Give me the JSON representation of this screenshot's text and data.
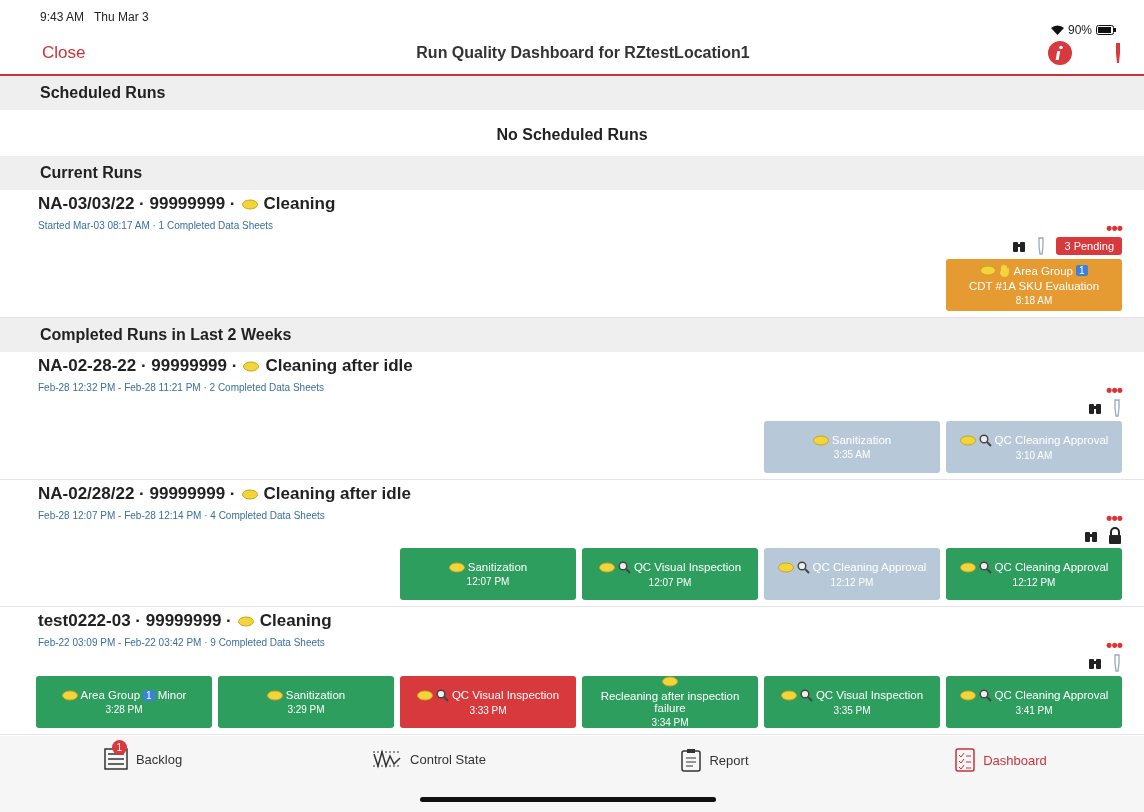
{
  "status_bar": {
    "time": "9:43 AM",
    "date": "Thu Mar 3",
    "battery": "90%"
  },
  "nav": {
    "close": "Close",
    "title": "Run Quality Dashboard for RZtestLocation1"
  },
  "scheduled": {
    "header": "Scheduled Runs",
    "empty": "No Scheduled Runs"
  },
  "current": {
    "header": "Current Runs",
    "runs": [
      {
        "title": "NA-03/03/22 · 99999999 ·",
        "activity": "Cleaning",
        "subtitle": "Started Mar-03 08:17 AM · 1 Completed Data Sheets",
        "menu": "•••",
        "badge": "3 Pending",
        "locked": false,
        "cards": [
          {
            "kind": "area",
            "color": "#e69a32",
            "label": "Area Group",
            "tag": "1",
            "label_2": "CDT #1A SKU Evaluation",
            "time": "8:18 AM"
          }
        ]
      }
    ]
  },
  "completed": {
    "header": "Completed Runs in Last 2 Weeks",
    "runs": [
      {
        "title": "NA-02-28-22 · 99999999 ·",
        "activity": "Cleaning after idle",
        "subtitle": "Feb-28 12:32 PM - Feb-28 11:21 PM · 2 Completed Data Sheets",
        "menu": "•••",
        "locked": false,
        "cards": [
          {
            "kind": "cleaning",
            "color": "#b7c9d8",
            "label": "Sanitization",
            "time": "3:35 AM"
          },
          {
            "kind": "inspection",
            "color": "#b7c9d8",
            "label": "QC Cleaning Approval",
            "time": "3:10 AM"
          }
        ]
      },
      {
        "title": "NA-02/28/22 · 99999999 ·",
        "activity": "Cleaning after idle",
        "subtitle": "Feb-28 12:07 PM - Feb-28 12:14 PM · 4 Completed Data Sheets",
        "menu": "•••",
        "locked": true,
        "cards": [
          {
            "kind": "cleaning",
            "color": "#2e9e5e",
            "label": "Sanitization",
            "time": "12:07 PM"
          },
          {
            "kind": "inspection",
            "color": "#2e9e5e",
            "label": "QC Visual Inspection",
            "time": "12:07 PM"
          },
          {
            "kind": "inspection",
            "color": "#b7c9d8",
            "label": "QC Cleaning Approval",
            "time": "12:12 PM"
          },
          {
            "kind": "inspection",
            "color": "#2e9e5e",
            "label": "QC Cleaning Approval",
            "time": "12:12 PM"
          }
        ]
      },
      {
        "title": "test0222-03 · 99999999 ·",
        "activity": "Cleaning",
        "subtitle": "Feb-22 03:09 PM - Feb-22 03:42 PM · 9 Completed Data Sheets",
        "menu": "•••",
        "locked": false,
        "cards": [
          {
            "kind": "cleaning",
            "color": "#2e9e5e",
            "label": "Area Group",
            "tag": "1",
            "label_2": "Minor",
            "time": "3:28 PM"
          },
          {
            "kind": "cleaning",
            "color": "#2e9e5e",
            "label": "Sanitization",
            "time": "3:29 PM"
          },
          {
            "kind": "inspection",
            "color": "#d8393c",
            "label": "QC Visual Inspection",
            "time": "3:33 PM"
          },
          {
            "kind": "cleaning",
            "color": "#2e9e5e",
            "label": "Recleaning after inspection failure",
            "time": "3:34 PM"
          },
          {
            "kind": "inspection",
            "color": "#2e9e5e",
            "label": "QC Visual Inspection",
            "time": "3:35 PM"
          },
          {
            "kind": "inspection",
            "color": "#2e9e5e",
            "label": "QC Cleaning Approval",
            "time": "3:41 PM"
          }
        ]
      }
    ]
  },
  "tabs": [
    {
      "label": "Backlog",
      "badge": "1",
      "selected": false
    },
    {
      "label": "Control State",
      "selected": false
    },
    {
      "label": "Report",
      "selected": false
    },
    {
      "label": "Dashboard",
      "selected": true
    }
  ]
}
